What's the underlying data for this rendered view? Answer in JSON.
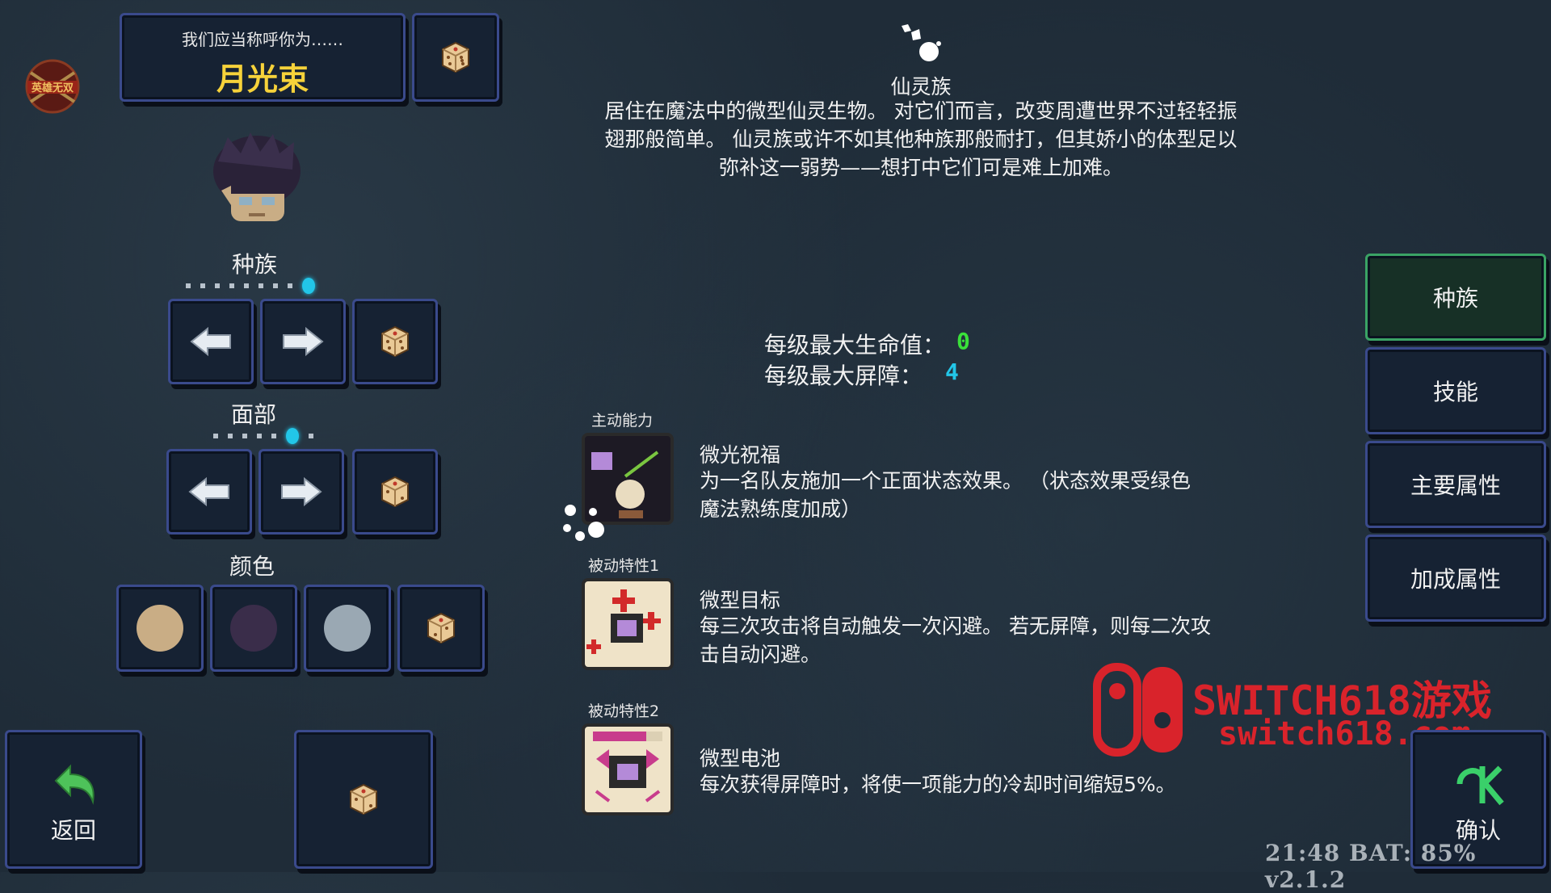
{
  "header": {
    "prompt": "我们应当称呼你为……",
    "name": "月光束",
    "logo_text": "英雄无双"
  },
  "sections": {
    "race": "种族",
    "face": "面部",
    "color": "颜色"
  },
  "colors": {
    "swatches": [
      "#c9ad85",
      "#3a2d4a",
      "#9aa8b3"
    ],
    "accent_cyan": "#22c6e8",
    "name_yellow": "#f6d23a"
  },
  "race_info": {
    "name": "仙灵族",
    "description_lines": [
      "居住在魔法中的微型仙灵生物。 对它们而言，改变周遭世界不过轻轻振",
      "翅那般简单。 仙灵族或许不如其他种族那般耐打，但其娇小的体型足以",
      "弥补这一弱势——想打中它们可是难上加难。"
    ]
  },
  "stats": {
    "hp_label": "每级最大生命值：",
    "hp_value": "0",
    "shield_label": "每级最大屏障：",
    "shield_value": "4"
  },
  "abilities": [
    {
      "tag": "主动能力",
      "title": "微光祝福",
      "lines": [
        "为一名队友施加一个正面状态效果。   （状态效果受绿色",
        "魔法熟练度加成）"
      ]
    },
    {
      "tag": "被动特性1",
      "title": "微型目标",
      "lines": [
        "每三次攻击将自动触发一次闪避。 若无屏障，则每二次攻",
        "击自动闪避。"
      ]
    },
    {
      "tag": "被动特性2",
      "title": "微型电池",
      "lines": [
        "每次获得屏障时，将使一项能力的冷却时间缩短5%。"
      ]
    }
  ],
  "tabs": [
    {
      "label": "种族",
      "active": true
    },
    {
      "label": "技能",
      "active": false
    },
    {
      "label": "主要属性",
      "active": false
    },
    {
      "label": "加成属性",
      "active": false
    }
  ],
  "footer": {
    "back_label": "返回",
    "confirm_label": "确认",
    "status_text": "21:48 BAT: 85% v2.1.2"
  },
  "watermark": {
    "line1": "SWITCH618游戏",
    "line2": "switch618.com"
  }
}
